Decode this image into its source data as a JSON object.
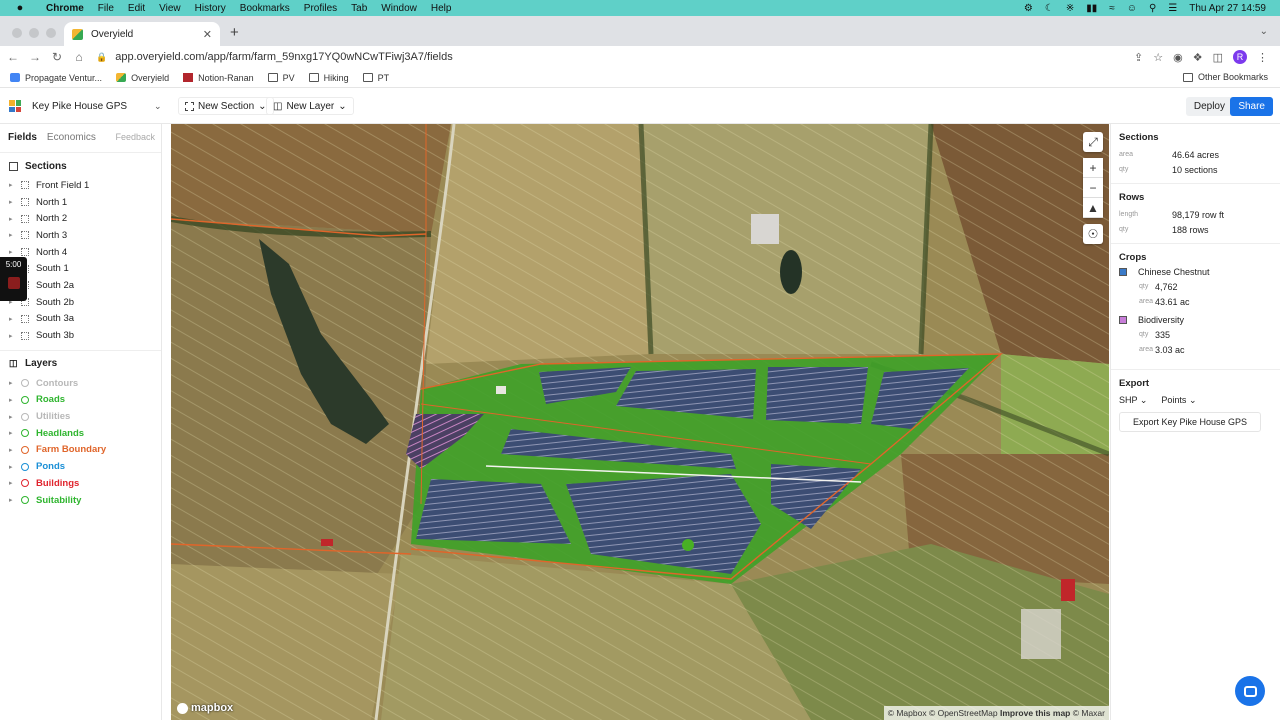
{
  "menubar": {
    "app": "Chrome",
    "items": [
      "File",
      "Edit",
      "View",
      "History",
      "Bookmarks",
      "Profiles",
      "Tab",
      "Window",
      "Help"
    ],
    "datetime": "Thu Apr 27  14:59"
  },
  "browser": {
    "tab_title": "Overyield",
    "url": "app.overyield.com/app/farm/farm_59nxg17YQ0wNCwTFiwj3A7/fields",
    "bookmarks": [
      "Propagate Ventur...",
      "Overyield",
      "Notion-Ranan",
      "PV",
      "Hiking",
      "PT"
    ],
    "other_bookmarks": "Other Bookmarks",
    "profile_initial": "R"
  },
  "header": {
    "farm_name": "Key Pike House GPS",
    "new_section": "New Section",
    "new_layer": "New Layer",
    "deploy": "Deploy",
    "share": "Share"
  },
  "sidebar": {
    "tabs": {
      "fields": "Fields",
      "economics": "Economics",
      "feedback": "Feedback"
    },
    "sections_title": "Sections",
    "sections": [
      "Front Field 1",
      "North 1",
      "North 2",
      "North 3",
      "North 4",
      "South 1",
      "South 2a",
      "South 2b",
      "South 3a",
      "South 3b"
    ],
    "layers_title": "Layers",
    "layers": [
      {
        "label": "Contours",
        "color": "#b8b8b8"
      },
      {
        "label": "Roads",
        "color": "#2fb52f"
      },
      {
        "label": "Utilities",
        "color": "#b8b8b8"
      },
      {
        "label": "Headlands",
        "color": "#2fb52f"
      },
      {
        "label": "Farm Boundary",
        "color": "#e0652a"
      },
      {
        "label": "Ponds",
        "color": "#1a8fd6"
      },
      {
        "label": "Buildings",
        "color": "#e0242e"
      },
      {
        "label": "Suitability",
        "color": "#2fb52f"
      }
    ]
  },
  "video_overlay": {
    "time": "5:00"
  },
  "right_panel": {
    "sections": {
      "title": "Sections",
      "area_label": "area",
      "area": "46.64 acres",
      "qty_label": "qty",
      "qty": "10 sections"
    },
    "rows": {
      "title": "Rows",
      "length_label": "length",
      "length": "98,179 row ft",
      "qty_label": "qty",
      "qty": "188 rows"
    },
    "crops_title": "Crops",
    "crops": [
      {
        "name": "Chinese Chestnut",
        "color": "#3a7ac8",
        "qty_label": "qty",
        "qty": "4,762",
        "area_label": "area",
        "area": "43.61 ac"
      },
      {
        "name": "Biodiversity",
        "color": "#c77dd8",
        "qty_label": "qty",
        "qty": "335",
        "area_label": "area",
        "area": "3.03 ac"
      }
    ],
    "export": {
      "title": "Export",
      "format": "SHP",
      "type": "Points",
      "button": "Export Key Pike House GPS"
    }
  },
  "map": {
    "logo": "mapbox",
    "attribution": {
      "mapbox": "© Mapbox",
      "osm": "© OpenStreetMap",
      "improve": "Improve this map",
      "maxar": "© Maxar"
    }
  }
}
